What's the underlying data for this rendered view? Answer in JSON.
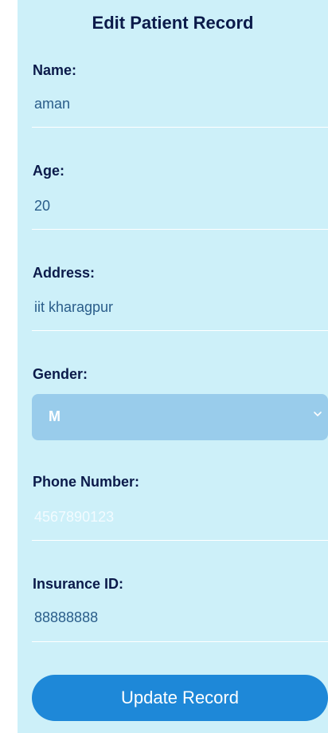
{
  "form": {
    "title": "Edit Patient Record",
    "fields": {
      "name": {
        "label": "Name:",
        "value": "aman"
      },
      "age": {
        "label": "Age:",
        "value": "20"
      },
      "address": {
        "label": "Address:",
        "value": "iit kharagpur"
      },
      "gender": {
        "label": "Gender:",
        "value": "M"
      },
      "phone": {
        "label": "Phone Number:",
        "value": "4567890123"
      },
      "insurance": {
        "label": "Insurance ID:",
        "value": "88888888"
      }
    },
    "submit_label": "Update Record"
  },
  "colors": {
    "panel_bg": "#cdf0f9",
    "label_text": "#0b1a4a",
    "value_text": "#2a5d8a",
    "select_bg": "#99cceb",
    "button_bg": "#1e88d8"
  }
}
